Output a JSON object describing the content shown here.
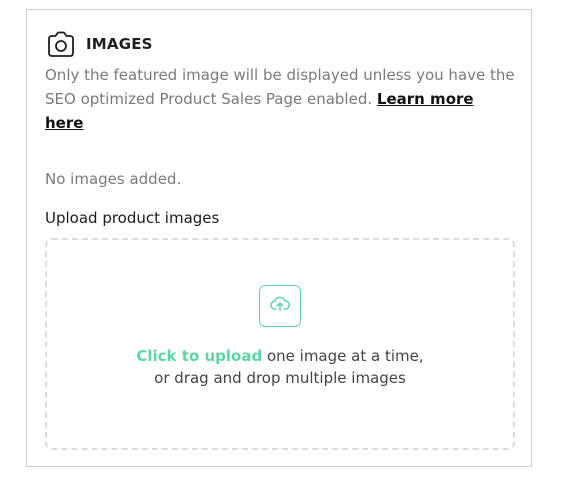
{
  "section": {
    "title": "IMAGES",
    "icon": "camera-icon",
    "description": "Only the featured image will be displayed unless you have the SEO optimized Product Sales Page enabled.",
    "learn_more": "Learn more here",
    "empty_state": "No images added."
  },
  "upload": {
    "label": "Upload product images",
    "icon": "upload-cloud-icon",
    "click_text": "Click to upload",
    "line1_rest": "one image at a time,",
    "line2": "or drag and drop multiple images"
  },
  "colors": {
    "accent": "#5ed6a2",
    "muted_text": "#7a7a7a",
    "border": "#cfcfcf",
    "dash": "#dcdcdc"
  }
}
